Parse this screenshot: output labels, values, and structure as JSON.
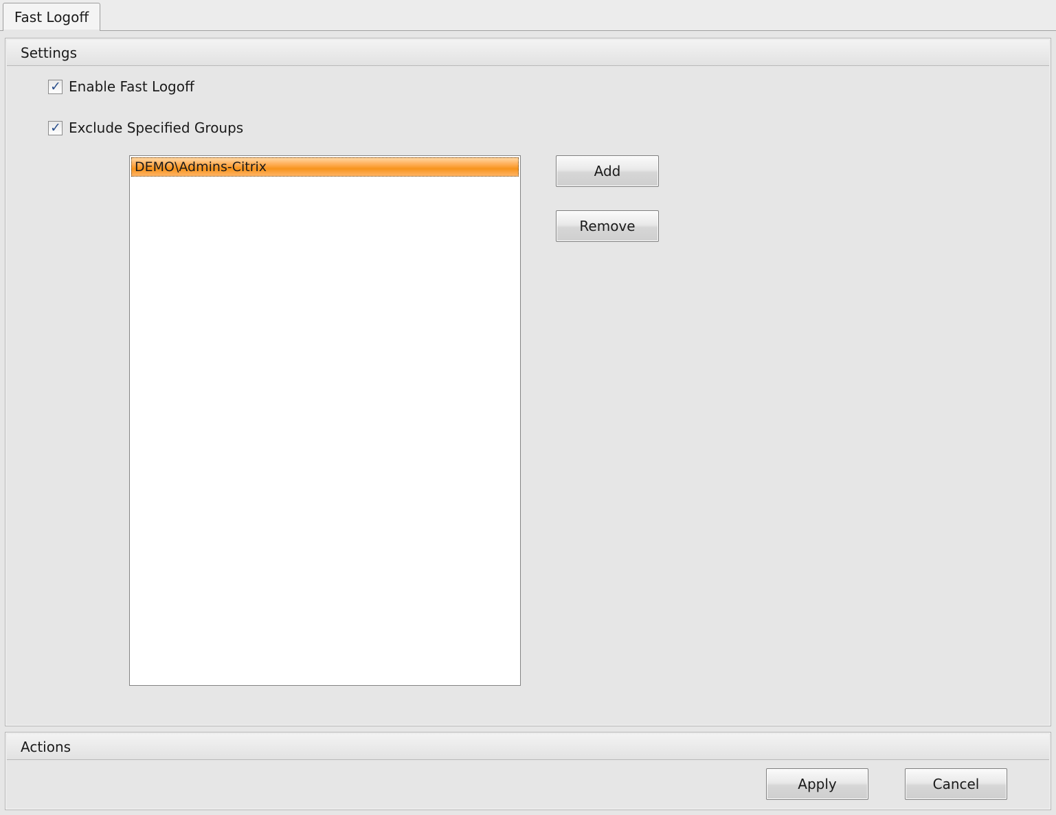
{
  "tabs": [
    {
      "label": "Fast Logoff",
      "selected": true
    }
  ],
  "settings": {
    "header": "Settings",
    "enable_fast_logoff": {
      "label": "Enable Fast Logoff",
      "checked": true
    },
    "exclude_groups": {
      "label": "Exclude Specified Groups",
      "checked": true
    },
    "groups_list": {
      "items": [
        "DEMO\\Admins-Citrix"
      ],
      "selected_index": 0
    },
    "add_label": "Add",
    "remove_label": "Remove"
  },
  "actions": {
    "header": "Actions",
    "apply_label": "Apply",
    "cancel_label": "Cancel"
  },
  "colors": {
    "selection_highlight": "#f7941d",
    "checkmark": "#2a4f8c",
    "background": "#e6e6e6"
  }
}
